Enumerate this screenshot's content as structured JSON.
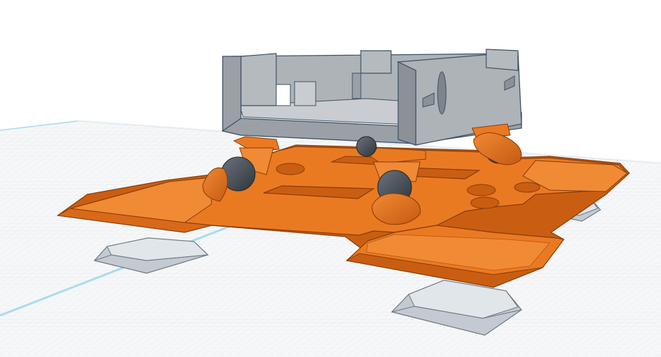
{
  "app": {
    "view": "3d-workplane"
  },
  "colors": {
    "background": "#ffffff",
    "grid_fill": "#f1f3f5",
    "grid_line_minor": "#d9dde2",
    "grid_line_major": "#c4cad1",
    "axis_line": "#a8dcef",
    "plate_top": "#ea7a22",
    "plate_side": "#c95e12",
    "plate_edge": "#8a3c08",
    "feet_top": "#dfe4ea",
    "feet_side": "#b8c0c9",
    "feet_edge": "#6f7780",
    "case_light": "#aeb3b8",
    "case_mid": "#9aa0a6",
    "case_dark": "#7d848b",
    "case_edge": "#3f5266",
    "ball": "#3f4650",
    "ball_highlight": "#6b737d"
  },
  "scene": {
    "objects": [
      {
        "name": "grey-enclosure",
        "color": "grey"
      },
      {
        "name": "orange-mount-plate",
        "color": "orange"
      },
      {
        "name": "ball-joint-feet",
        "count": 4
      },
      {
        "name": "grey-pads",
        "count": 3
      }
    ]
  }
}
